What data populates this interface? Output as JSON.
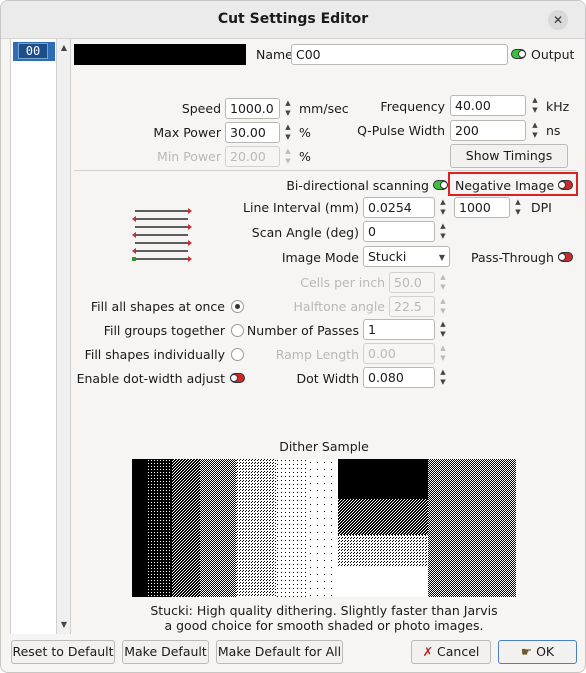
{
  "window": {
    "title": "Cut Settings Editor",
    "close_glyph": "✕"
  },
  "layer_list": {
    "items": [
      "00"
    ]
  },
  "header": {
    "name_label": "Name",
    "name_value": "C00",
    "output_label": "Output",
    "output_on": true,
    "layer_color": "#000000"
  },
  "speed": {
    "label": "Speed",
    "value": "1000.0",
    "unit": "mm/sec"
  },
  "max_power": {
    "label": "Max Power",
    "value": "30.00",
    "unit": "%"
  },
  "min_power": {
    "label": "Min Power",
    "value": "20.00",
    "unit": "%"
  },
  "frequency": {
    "label": "Frequency",
    "value": "40.00",
    "unit": "kHz"
  },
  "qpulse": {
    "label": "Q-Pulse Width",
    "value": "200",
    "unit": "ns"
  },
  "show_timings": "Show Timings",
  "bidir": {
    "label": "Bi-directional scanning",
    "on": true
  },
  "negative": {
    "label": "Negative Image",
    "on": false
  },
  "line_interval": {
    "label": "Line Interval (mm)",
    "value": "0.0254",
    "dpi_value": "1000",
    "dpi_unit": "DPI"
  },
  "scan_angle": {
    "label": "Scan Angle (deg)",
    "value": "0"
  },
  "image_mode": {
    "label": "Image Mode",
    "value": "Stucki"
  },
  "pass_through": {
    "label": "Pass-Through",
    "on": false
  },
  "cells_per_inch": {
    "label": "Cells per inch",
    "value": "50.0"
  },
  "halftone_angle": {
    "label": "Halftone angle",
    "value": "22.5"
  },
  "fill_options": [
    {
      "label": "Fill all shapes at once",
      "checked": true
    },
    {
      "label": "Fill groups together",
      "checked": false
    },
    {
      "label": "Fill shapes individually",
      "checked": false
    }
  ],
  "dot_width_adjust": {
    "label": "Enable dot-width adjust",
    "on": false
  },
  "passes": {
    "label": "Number of Passes",
    "value": "1"
  },
  "ramp_length": {
    "label": "Ramp Length",
    "value": "0.00"
  },
  "dot_width": {
    "label": "Dot Width",
    "value": "0.080"
  },
  "dither": {
    "title": "Dither Sample",
    "desc_line1": "Stucki: High quality dithering. Slightly faster than Jarvis",
    "desc_line2": "a good choice for smooth shaded or photo images."
  },
  "footer": {
    "reset": "Reset to Default",
    "make_default": "Make Default",
    "make_default_all": "Make Default for All",
    "cancel": "Cancel",
    "ok": "OK"
  },
  "colors": {
    "accent": "#2e6db4",
    "highlight": "#e02020",
    "toggle_on": "#3ac23a",
    "toggle_off": "#c92a2a"
  }
}
